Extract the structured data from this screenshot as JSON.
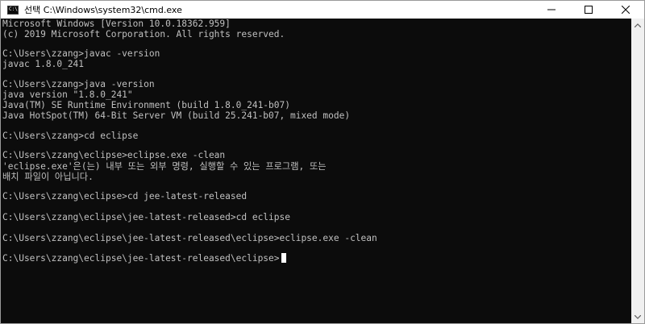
{
  "window": {
    "title": "선택 C:\\Windows\\system32\\cmd.exe",
    "icon": "cmd-icon",
    "controls": [
      "minimize-icon",
      "maximize-icon",
      "close-icon"
    ]
  },
  "console": {
    "lines": [
      "Microsoft Windows [Version 10.0.18362.959]",
      "(c) 2019 Microsoft Corporation. All rights reserved.",
      "",
      "C:\\Users\\zzang>javac -version",
      "javac 1.8.0_241",
      "",
      "C:\\Users\\zzang>java -version",
      "java version \"1.8.0_241\"",
      "Java(TM) SE Runtime Environment (build 1.8.0_241-b07)",
      "Java HotSpot(TM) 64-Bit Server VM (build 25.241-b07, mixed mode)",
      "",
      "C:\\Users\\zzang>cd eclipse",
      "",
      "C:\\Users\\zzang\\eclipse>eclipse.exe -clean",
      "'eclipse.exe'은(는) 내부 또는 외부 명령, 실행할 수 있는 프로그램, 또는",
      "배치 파일이 아닙니다.",
      "",
      "C:\\Users\\zzang\\eclipse>cd jee-latest-released",
      "",
      "C:\\Users\\zzang\\eclipse\\jee-latest-released>cd eclipse",
      "",
      "C:\\Users\\zzang\\eclipse\\jee-latest-released\\eclipse>eclipse.exe -clean",
      "",
      "C:\\Users\\zzang\\eclipse\\jee-latest-released\\eclipse>"
    ]
  },
  "colors": {
    "console_bg": "#0c0c0c",
    "console_fg": "#c0c0c0",
    "titlebar_bg": "#ffffff"
  }
}
